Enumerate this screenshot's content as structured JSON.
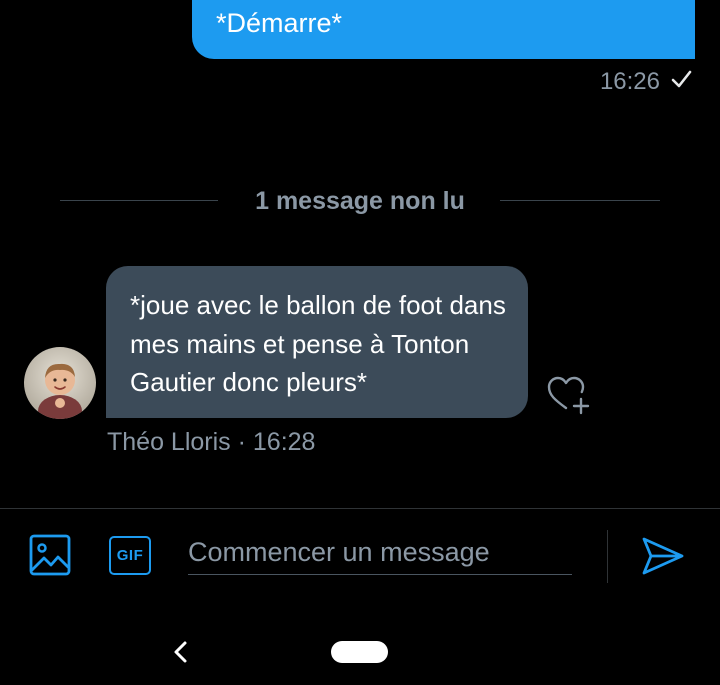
{
  "sent_message": {
    "text": "*Démarre*",
    "time": "16:26",
    "status_icon": "check-icon"
  },
  "unread_divider": {
    "label": "1 message non lu"
  },
  "received_message": {
    "text": "*joue avec le ballon de foot dans mes mains et pense à Tonton Gautier donc pleurs*",
    "meta": "Théo Lloris · 16:28",
    "avatar_icon": "avatar-photo",
    "reaction_icon": "heart-plus-icon"
  },
  "composer": {
    "placeholder": "Commencer un message",
    "gif_label": "GIF",
    "image_icon": "image-icon",
    "send_icon": "send-icon"
  },
  "nav": {
    "back_icon": "back-chevron-icon",
    "home_icon": "home-pill"
  },
  "colors": {
    "accent": "#1d9bf0",
    "background": "#000000",
    "received_bubble": "#3c4b59",
    "secondary_text": "#8b98a5"
  }
}
